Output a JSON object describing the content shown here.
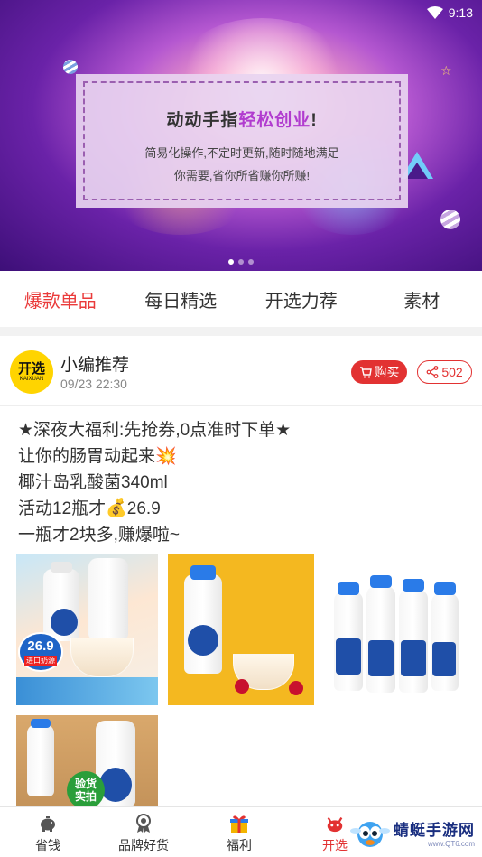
{
  "status_bar": {
    "time": "9:13"
  },
  "banner": {
    "title_prefix": "动动手指",
    "title_highlight": "轻松创业",
    "title_suffix": "!",
    "line1": "简易化操作,不定时更新,随时随地满足",
    "line2": "你需要,省你所省赚你所赚!",
    "dot_count": 3,
    "active_dot": 0
  },
  "tabs": [
    {
      "label": "爆款单品",
      "active": true
    },
    {
      "label": "每日精选",
      "active": false
    },
    {
      "label": "开选力荐",
      "active": false
    },
    {
      "label": "素材",
      "active": false
    }
  ],
  "post": {
    "logo_text": "开选",
    "logo_subtext": "KAIXUAN",
    "author": "小编推荐",
    "time": "09/23 22:30",
    "buy_label": "购买",
    "share_count": "502",
    "content_lines": [
      "★深夜大福利:先抢券,0点准时下单★",
      "让你的肠胃动起来💥",
      "椰汁岛乳酸菌340ml",
      "活动12瓶才💰26.9",
      "一瓶才2块多,赚爆啦~"
    ],
    "images": {
      "img1_price": "26.9",
      "img1_tag": "进口奶源",
      "img4_badge_line1": "验货",
      "img4_badge_line2": "实拍"
    }
  },
  "bottom_nav": [
    {
      "label": "省钱",
      "icon": "piggy-bank-icon",
      "active": false
    },
    {
      "label": "品牌好货",
      "icon": "medal-icon",
      "active": false
    },
    {
      "label": "福利",
      "icon": "gift-icon",
      "active": false
    },
    {
      "label": "开选",
      "icon": "mascot-icon",
      "active": true
    }
  ],
  "watermark": {
    "main": "蜻蜓手游网",
    "sub": "www.QT6.com"
  },
  "colors": {
    "accent": "#e23232",
    "logo_yellow": "#ffd400",
    "banner_purple": "#5a1c98"
  }
}
